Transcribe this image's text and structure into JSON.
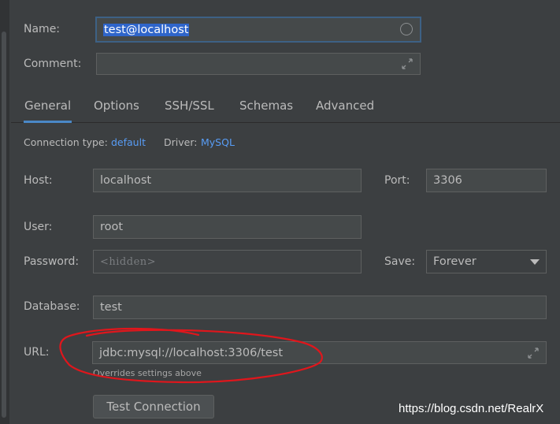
{
  "general": {
    "name_label": "Name:",
    "name_value": "test@localhost",
    "comment_label": "Comment:",
    "comment_value": ""
  },
  "tabs": [
    {
      "label": "General",
      "active": true
    },
    {
      "label": "Options"
    },
    {
      "label": "SSH/SSL"
    },
    {
      "label": "Schemas"
    },
    {
      "label": "Advanced"
    }
  ],
  "connection": {
    "type_label": "Connection type:",
    "type_value": "default",
    "driver_label": "Driver:",
    "driver_value": "MySQL"
  },
  "fields": {
    "host_label": "Host:",
    "host_value": "localhost",
    "port_label": "Port:",
    "port_value": "3306",
    "user_label": "User:",
    "user_value": "root",
    "password_label": "Password:",
    "password_placeholder": "<hidden>",
    "save_label": "Save:",
    "save_value": "Forever",
    "database_label": "Database:",
    "database_value": "test",
    "url_label": "URL:",
    "url_value": "jdbc:mysql://localhost:3306/test",
    "url_hint": "Overrides settings above"
  },
  "buttons": {
    "test_connection": "Test Connection"
  },
  "watermark": "https://blog.csdn.net/RealrX",
  "colors": {
    "background": "#3c3f41",
    "field_bg": "#45494a",
    "link": "#589df6",
    "tab_underline": "#4a88c7",
    "selection": "#2f65ca",
    "annotation": "#e0161c"
  },
  "icons": [
    "expand-icon",
    "clear-circle-icon",
    "dropdown-arrow-icon"
  ]
}
